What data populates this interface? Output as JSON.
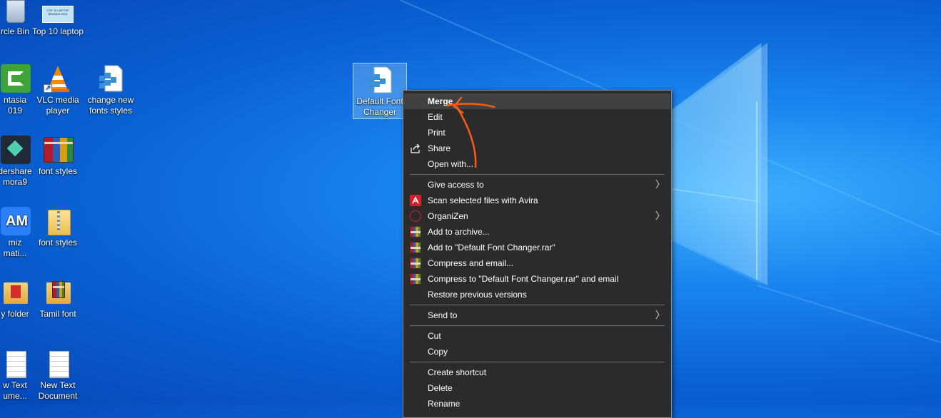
{
  "desktop": {
    "icons": [
      {
        "label": "rcle Bin"
      },
      {
        "label": "Top 10 laptop"
      },
      {
        "label": "ntasia\n019"
      },
      {
        "label": "VLC media\nplayer"
      },
      {
        "label": "change new\nfonts styles"
      },
      {
        "label": "Default Font\nChanger"
      },
      {
        "label": "dershare\nmora9"
      },
      {
        "label": "font styles"
      },
      {
        "label": "AM",
        "sub": "miz\nmati..."
      },
      {
        "label": "font styles"
      },
      {
        "label": "y folder"
      },
      {
        "label": "Tamil font"
      },
      {
        "label": "w Text\nume..."
      },
      {
        "label": "New Text\nDocument"
      }
    ],
    "thumb_text": "TOP 10 LAPTOP BRANDS 2019"
  },
  "context_menu": {
    "items": [
      {
        "label": "Merge"
      },
      {
        "label": "Edit"
      },
      {
        "label": "Print"
      },
      {
        "label": "Share",
        "icon": "share-icon"
      },
      {
        "label": "Open with..."
      },
      {
        "label": "Give access to",
        "submenu": true
      },
      {
        "label": "Scan selected files with Avira",
        "icon": "avira-icon"
      },
      {
        "label": "OrganiZen",
        "icon": "organizen-icon",
        "submenu": true
      },
      {
        "label": "Add to archive...",
        "icon": "winrar-icon"
      },
      {
        "label": "Add to \"Default Font Changer.rar\"",
        "icon": "winrar-icon"
      },
      {
        "label": "Compress and email...",
        "icon": "winrar-icon"
      },
      {
        "label": "Compress to \"Default Font Changer.rar\" and email",
        "icon": "winrar-icon"
      },
      {
        "label": "Restore previous versions"
      },
      {
        "label": "Send to",
        "submenu": true
      },
      {
        "label": "Cut"
      },
      {
        "label": "Copy"
      },
      {
        "label": "Create shortcut"
      },
      {
        "label": "Delete"
      },
      {
        "label": "Rename"
      }
    ],
    "submenu_arrow": "〉"
  },
  "annotation": {
    "color": "#ff5a14"
  }
}
